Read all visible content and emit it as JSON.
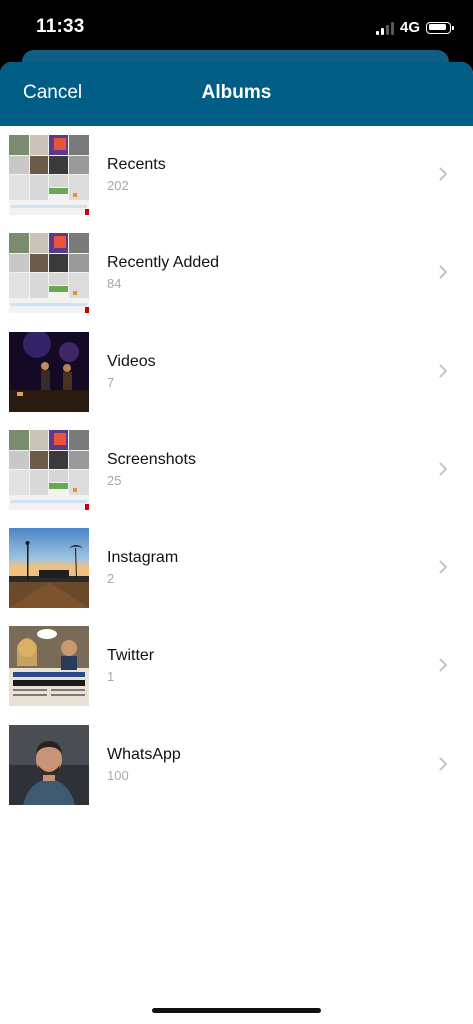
{
  "status_bar": {
    "time": "11:33",
    "network": "4G",
    "signal_icon": "cellular-signal-icon",
    "battery_icon": "battery-icon"
  },
  "nav": {
    "cancel_label": "Cancel",
    "title": "Albums",
    "background_color": "#005d86"
  },
  "albums": [
    {
      "name": "Recents",
      "count": "202",
      "thumb": "screenshot-collage"
    },
    {
      "name": "Recently Added",
      "count": "84",
      "thumb": "screenshot-collage"
    },
    {
      "name": "Videos",
      "count": "7",
      "thumb": "concert-stage-photo"
    },
    {
      "name": "Screenshots",
      "count": "25",
      "thumb": "screenshot-collage"
    },
    {
      "name": "Instagram",
      "count": "2",
      "thumb": "sunset-palm-trees-photo"
    },
    {
      "name": "Twitter",
      "count": "1",
      "thumb": "newspaper-clipping-photo"
    },
    {
      "name": "WhatsApp",
      "count": "100",
      "thumb": "man-portrait-photo"
    }
  ],
  "row_icon": "chevron-right-icon"
}
